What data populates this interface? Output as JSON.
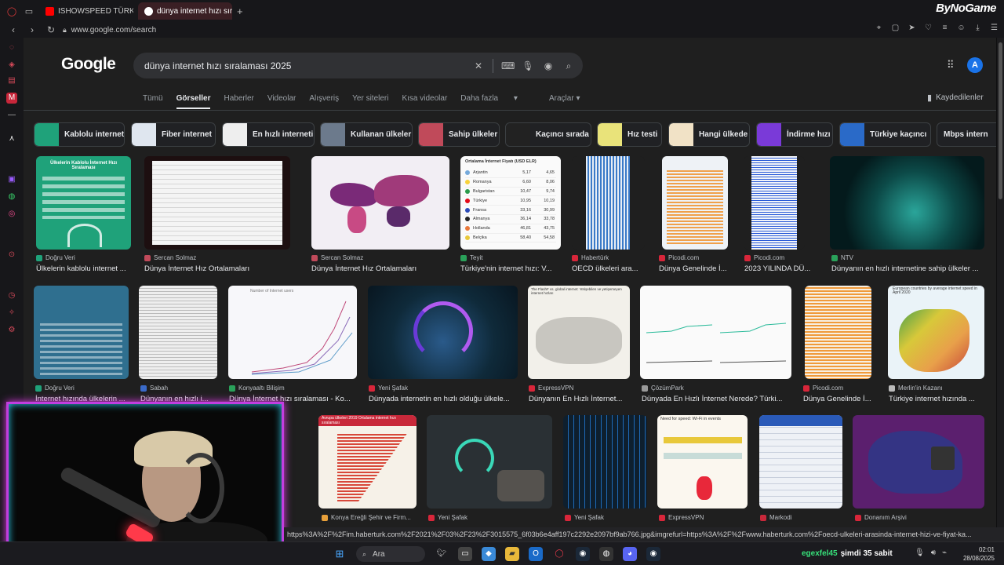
{
  "tabs": [
    {
      "label": "ISHOWSPEED TÜRKİYE R",
      "color": "#ff0000"
    },
    {
      "label": "dünya internet hızı sıralama",
      "color": "#4285f4"
    }
  ],
  "brand": "ByNoGame",
  "address_url": "www.google.com/search",
  "google": {
    "logo": "Google",
    "query": "dünya internet hızı sıralaması 2025",
    "avatar": "A",
    "nav_tabs": [
      "Tümü",
      "Görseller",
      "Haberler",
      "Videolar",
      "Alışveriş",
      "Yer siteleri",
      "Kısa videolar",
      "Daha fazla"
    ],
    "selected_tab": "Görseller",
    "tools": "Araçlar",
    "saved": "Kaydedilenler"
  },
  "chips": [
    "Kablolu internet",
    "Fiber internet",
    "En hızlı interneti",
    "Kullanan ülkeler",
    "Sahip ülkeler",
    "Kaçıncı sırada",
    "Hız testi",
    "Hangi ülkede",
    "İndirme hızı",
    "Türkiye kaçıncı",
    "Mbps intern"
  ],
  "results": [
    {
      "source": "Doğru Veri",
      "caption": "Ülkelerin kablolu internet ...",
      "color": "#1fa27a"
    },
    {
      "source": "Sercan Solmaz",
      "caption": "Dünya İnternet Hız Ortalamaları",
      "color": "#f4f4f4"
    },
    {
      "source": "Sercan Solmaz",
      "caption": "Dünya İnternet Hız Ortalamaları",
      "color": "#f2eef4"
    },
    {
      "source": "Teyit",
      "caption": "Türkiye'nin internet hızı: V...",
      "color": "#fafafa"
    },
    {
      "source": "Habertürk",
      "caption": "OECD ülkeleri ara...",
      "color": "#e8eef5"
    },
    {
      "source": "Picodi.com",
      "caption": "Dünya Genelinde İ...",
      "color": "#eef2f6"
    },
    {
      "source": "Picodi.com",
      "caption": "2023 YILINDA DÜ...",
      "color": "#f3f5f9"
    },
    {
      "source": "NTV",
      "caption": "Dünyanın en hızlı internetine sahip ülkeler ...",
      "color": "#0c3a3a"
    },
    {
      "source": "Doğru Veri",
      "caption": "İnternet hızında ülkelerin ...",
      "color": "#2f6f8f"
    },
    {
      "source": "Sabah",
      "caption": "Dünyanın en hızlı i...",
      "color": "#eeeeee"
    },
    {
      "source": "Konyaaltı Bilişim",
      "caption": "Dünya İnternet hızı sıralaması - Ko...",
      "color": "#f7f7fa"
    },
    {
      "source": "Yeni Şafak",
      "caption": "Dünyada internetin en hızlı olduğu ülkele...",
      "color": "#0f2a3a"
    },
    {
      "source": "ExpressVPN",
      "caption": "Dünyanın En Hızlı İnternet...",
      "color": "#f2f0ea"
    },
    {
      "source": "ÇözümPark",
      "caption": "Dünyada En Hızlı İnternet Nerede? Türki...",
      "color": "#fafafa"
    },
    {
      "source": "Picodi.com",
      "caption": "Dünya Genelinde İ...",
      "color": "#f7efe2"
    },
    {
      "source": "Merlin'in Kazanı",
      "caption": "Türkiye internet hızında ...",
      "color": "#eaf3f8"
    },
    {
      "source": "Konya Ereğli Şehir ve Firm...",
      "caption": "",
      "color": "#f6f1e8"
    },
    {
      "source": "Yeni Şafak",
      "caption": "",
      "color": "#2a3034"
    },
    {
      "source": "Yeni Şafak",
      "caption": "",
      "color": "#0e1f2e"
    },
    {
      "source": "ExpressVPN",
      "caption": "",
      "color": "#fbf7ef"
    },
    {
      "source": "Markodi",
      "caption": "",
      "color": "#eef1f6"
    },
    {
      "source": "Donanım Arşivi",
      "caption": "",
      "color": "#5b1f6e"
    }
  ],
  "thumb_texts": {
    "doru_title": "Ülkelerin Kablolu İnternet Hızı Sıralaması",
    "teyit_title": "Ortalama İnternet Fiyatı (USD ELR)",
    "teyit_rows": [
      [
        "Arjantin",
        "5,17",
        "4,65"
      ],
      [
        "Romanya",
        "6,60",
        "8,06"
      ],
      [
        "Bulgaristan",
        "10,47",
        "9,74"
      ],
      [
        "Türkiye",
        "10,95",
        "10,19"
      ],
      [
        "Fransa",
        "33,16",
        "30,99"
      ],
      [
        "Almanya",
        "36,14",
        "33,78"
      ],
      [
        "Hollanda",
        "46,81",
        "43,75"
      ],
      [
        "Belçika",
        "58,40",
        "54,58"
      ]
    ],
    "avrupa_title": "Avrupa ülkeleri 2019 Ortalama internet hızı sıralaması",
    "europe_title": "European countries by average internet speed in April 2020",
    "wifi_title": "Need for speed: Wi-Fi in events",
    "pn_title": "The FlashF vs. global internet: Yetişebilen ve yetişemeyen internet hızları",
    "konya_title": "Number of Internet users"
  },
  "status_url": "https%3A%2F%2Fim.haberturk.com%2F2021%2F03%2F23%2F3015575_6f03b6e4aff197c2292e2097bf9ab766.jpg&imgrefurl=https%3A%2F%2Fwww.haberturk.com%2Foecd-ulkeleri-arasinda-internet-hizi-ve-fiyat-ka...",
  "taskbar": {
    "search": "Ara",
    "notice_user": "egexfel45",
    "notice_text": "şimdi 35 sabit",
    "time": "02:01",
    "date": "28/08/2025"
  }
}
